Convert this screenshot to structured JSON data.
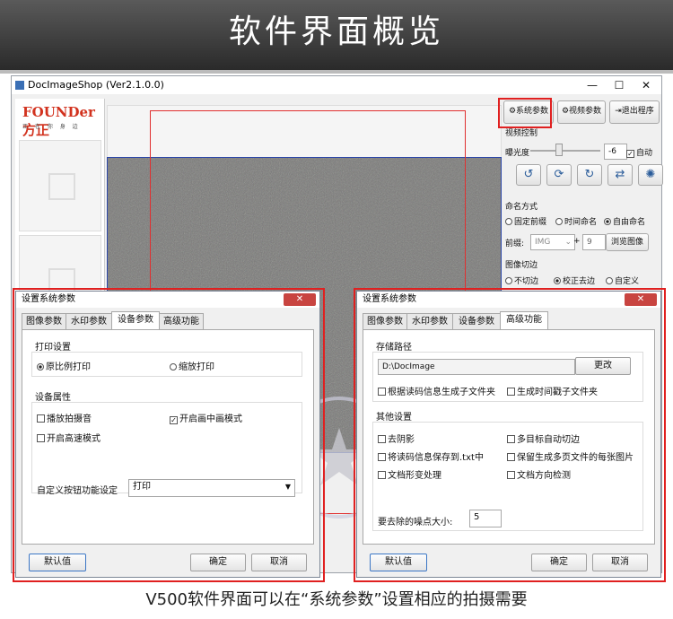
{
  "banner": {
    "title": "软件界面概览"
  },
  "window": {
    "title": "DocImageShop (Ver2.1.0.0)",
    "controls": {
      "minimize": "—",
      "maximize": "☐",
      "close": "✕"
    },
    "logo": "FOUNDer方正",
    "logo_sub": "正 在 你 身 边"
  },
  "toolbar": {
    "system_params": "系统参数",
    "video_params": "视频参数",
    "exit": "退出程序"
  },
  "video_control": {
    "title": "视频控制",
    "exposure_label": "曝光度",
    "exposure_value": "-6",
    "auto_label": "自动",
    "auto_checked": true,
    "exposure_level": 0.4
  },
  "naming": {
    "title": "命名方式",
    "options": [
      "固定前缀",
      "时间命名",
      "自由命名"
    ],
    "selected": "自由命名",
    "prefix_label": "前缀:",
    "prefix_value": "IMG",
    "plus": "+",
    "number_value": "9",
    "browse": "浏览图像"
  },
  "crop": {
    "title": "图像切边",
    "options": [
      "不切边",
      "校正去边",
      "自定义"
    ],
    "selected": "校正去边"
  },
  "dialog1": {
    "title": "设置系统参数",
    "close": "✕",
    "tabs": [
      "图像参数",
      "水印参数",
      "设备参数",
      "高级功能"
    ],
    "active_tab": "设备参数",
    "print_group": "打印设置",
    "print_opts": [
      "原比例打印",
      "缩放打印"
    ],
    "print_selected": "原比例打印",
    "device_group": "设备属性",
    "checks": [
      {
        "label": "播放拍摄音",
        "checked": false
      },
      {
        "label": "开启画中画模式",
        "checked": true
      },
      {
        "label": "开启高速模式",
        "checked": false
      }
    ],
    "custom_label": "自定义按钮功能设定",
    "custom_value": "打印",
    "default_btn": "默认值",
    "ok_btn": "确定",
    "cancel_btn": "取消"
  },
  "dialog2": {
    "title": "设置系统参数",
    "close": "✕",
    "tabs": [
      "图像参数",
      "水印参数",
      "设备参数",
      "高级功能"
    ],
    "active_tab": "高级功能",
    "storage_group": "存储路径",
    "path": "D:\\DocImage",
    "change_btn": "更改",
    "storage_checks": [
      {
        "label": "根据读码信息生成子文件夹",
        "checked": false
      },
      {
        "label": "生成时间戳子文件夹",
        "checked": false
      }
    ],
    "other_group": "其他设置",
    "other_checks": [
      {
        "label": "去阴影",
        "checked": false
      },
      {
        "label": "多目标自动切边",
        "checked": false
      },
      {
        "label": "将读码信息保存到.txt中",
        "checked": false
      },
      {
        "label": "保留生成多页文件的每张图片",
        "checked": false
      },
      {
        "label": "文档形变处理",
        "checked": false
      },
      {
        "label": "文档方向检测",
        "checked": false
      }
    ],
    "noise_label": "要去除的噪点大小:",
    "noise_value": "5",
    "default_btn": "默认值",
    "ok_btn": "确定",
    "cancel_btn": "取消"
  },
  "caption": "V500软件界面可以在“系统参数”设置相应的拍摄需要",
  "colors": {
    "highlight": "#e02020",
    "accent": "#2a5c9a"
  }
}
